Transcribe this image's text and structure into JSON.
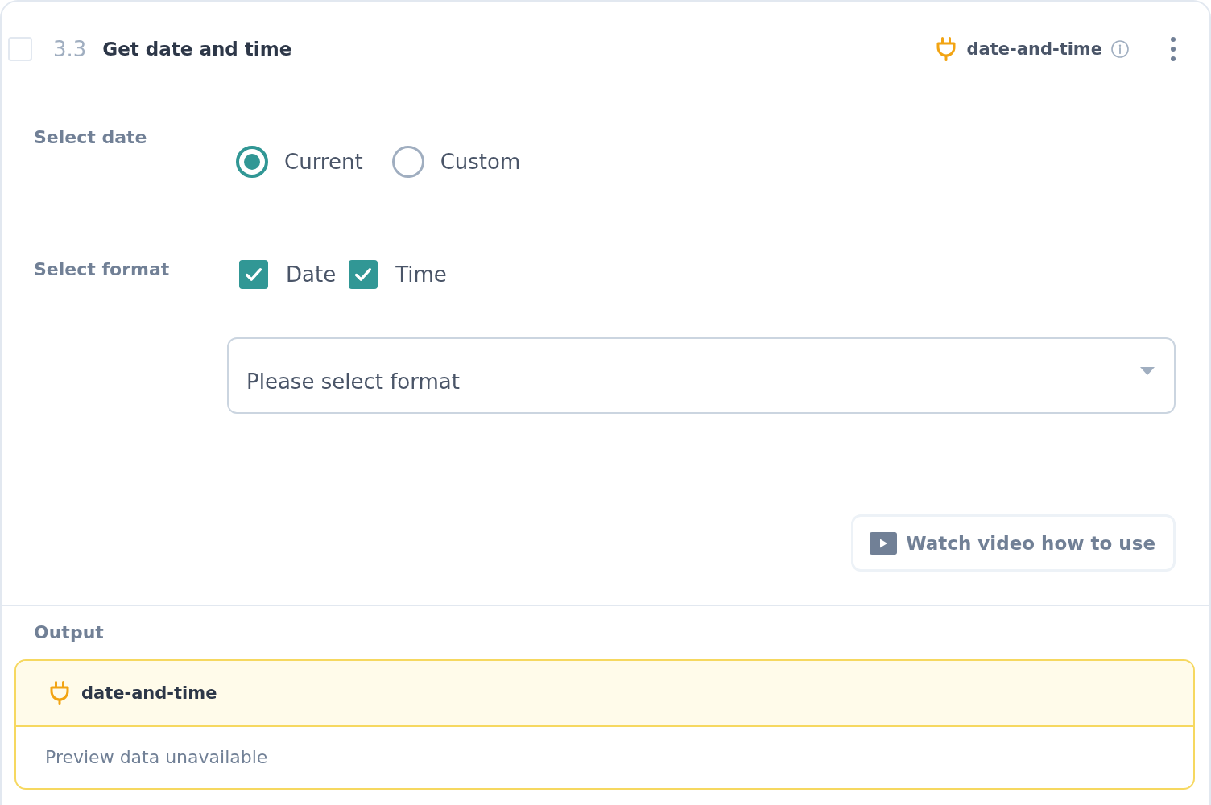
{
  "step": {
    "checked": false,
    "number": "3.3",
    "title": "Get date and time",
    "app_name": "date-and-time"
  },
  "fields": [
    {
      "kind": "radio",
      "label": "Select date",
      "options": [
        {
          "label": "Current",
          "selected": true
        },
        {
          "label": "Custom",
          "selected": false
        }
      ]
    },
    {
      "kind": "checkbox",
      "label": "Select format",
      "options": [
        {
          "label": "Date",
          "checked": true
        },
        {
          "label": "Time",
          "checked": true
        }
      ],
      "dropdown": {
        "placeholder": "Please select format"
      }
    }
  ],
  "video_button": {
    "label": "Watch video how to use"
  },
  "output": {
    "title": "Output",
    "app_name": "date-and-time",
    "preview": "Preview data unavailable"
  }
}
